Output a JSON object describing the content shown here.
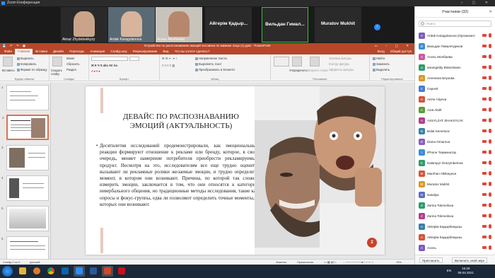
{
  "zoom": {
    "window_title": "Zoom Конференция",
    "participants": [
      {
        "name": "Aknur Zhydebekkyzy",
        "type": "video"
      },
      {
        "name": "Ardak Karagulanova",
        "type": "video"
      },
      {
        "name": "Асель Молбаева",
        "type": "video"
      },
      {
        "name": "Айгерім Қадыр...",
        "type": "name"
      },
      {
        "name": "Вильдан Гимал...",
        "type": "name"
      },
      {
        "name": "Muratov Mukhit",
        "type": "name"
      }
    ]
  },
  "ppt": {
    "title": "Устройство по распознаванию эмоций человека по мимике лица (1).pptx - PowerPoint",
    "tabs": [
      "Файл",
      "Главная",
      "Вставка",
      "Дизайн",
      "Переходы",
      "Анимация",
      "Слайд-шоу",
      "Рецензирование",
      "Вид",
      "Что вы хотите сделать?"
    ],
    "active_tab": "Главная",
    "account": "Вход",
    "share": "Общий доступ",
    "ribbon": {
      "paste": "Вставить",
      "cut": "Вырезать",
      "copy": "Копировать",
      "format_painter": "Формат по образцу",
      "clipboard": "Буфер обмена",
      "new_slide": "Создать слайд",
      "layout": "Макет",
      "reset": "Сбросить",
      "section": "Раздел",
      "slides": "Слайды",
      "font": "Шрифт",
      "paragraph": "Абзац",
      "text_direction": "Направление текста",
      "align_text": "Выровнять текст",
      "smartart": "Преобразовать в SmartArt",
      "arrange": "Упорядочить",
      "quick_styles": "Экспресс-стили",
      "shape_fill": "Заливка фигуры",
      "shape_outline": "Контур фигуры",
      "shape_effects": "Эффекты фигуры",
      "drawing": "Рисование",
      "find": "Найти",
      "replace": "Заменить",
      "select": "Выделить",
      "editing": "Редактирование"
    },
    "slide": {
      "number": "2",
      "title": "ДЕВАЙС ПО РАСПОЗНАВАНИЮ ЭМОЦИЙ (АКТУАЛЬНОСТЬ)",
      "body": "Десятилетия исследований продемонстрировали, как эмоциональные реакции формируют отношение к рекламе или бренду, которое, в свою очередь, меняет намерение потребителя приобрести рекламируемый продукт. Несмотря на это, исследователям все еще трудно оценить, вызывают ли рекламные ролики желаемые эмоции, и трудно определить момент, в котором они возникают. Причина, по которой так сложно измерить эмоции, заключается в том, что они относятся к категории невербального общения, но традиционные методы исследования, такие как опросы и фокус-группы, едва ли позволяют определить точные моменты, в которых они возникают."
    },
    "thumb_numbers": [
      "1",
      "2",
      "3",
      "4",
      "5",
      "6"
    ],
    "status": {
      "slide_count": "Слайд 2 из 9",
      "language": "русский",
      "notes": "Заметки",
      "comments": "Примечания",
      "zoom": "78%"
    }
  },
  "panel": {
    "title": "Участники (32)",
    "search_placeholder": "Поиск",
    "people": [
      {
        "name": "Ardak Karagulanova (Организатор)",
        "initial": "A",
        "color": "#7a5cc4"
      },
      {
        "name": "Вильдан Гималетдинов",
        "initial": "В",
        "color": "#3b8fd6"
      },
      {
        "name": "Асель Молбаева",
        "initial": "А",
        "color": "#c75b9b"
      },
      {
        "name": "amangeldy Bissenbaev",
        "initial": "a",
        "color": "#2f9c6a"
      },
      {
        "name": "Ангелина Беузова",
        "initial": "А",
        "color": "#d99a2b"
      },
      {
        "name": "Сергей",
        "initial": "С",
        "color": "#4a7bd0"
      },
      {
        "name": "Aiche Aliyeva",
        "initial": "A",
        "color": "#d4553b"
      },
      {
        "name": "Azat Abdil",
        "initial": "A",
        "color": "#5c9c3b"
      },
      {
        "name": "ASSYLZAT ZHAKSYLYK",
        "initial": "A",
        "color": "#b0408c"
      },
      {
        "name": "Bolat Kenessov",
        "initial": "B",
        "color": "#3b7fa8"
      },
      {
        "name": "Diana Omarova",
        "initial": "D",
        "color": "#8c5cc4"
      },
      {
        "name": "iPhone Терминатор",
        "initial": "i",
        "color": "#3b8fd6"
      },
      {
        "name": "Kalampyr Orazymbetova",
        "initial": "K",
        "color": "#2f9c6a"
      },
      {
        "name": "Marzhan Alkibayeva",
        "initial": "M",
        "color": "#d4553b"
      },
      {
        "name": "Muratov Mukhit",
        "initial": "M",
        "color": "#d99a2b"
      },
      {
        "name": "Nataliya",
        "initial": "N",
        "color": "#5b6fc4"
      },
      {
        "name": "Zarina Tokmeilova",
        "initial": "Z",
        "color": "#2f9c6a"
      },
      {
        "name": "Zarina Tokmeilova",
        "initial": "Z",
        "color": "#b0408c"
      },
      {
        "name": "Айгерім Кадырбекқызы",
        "initial": "А",
        "color": "#3b7fa8"
      },
      {
        "name": "Айгерім Кадырбекқызы",
        "initial": "А",
        "color": "#d4553b"
      },
      {
        "name": "Асель",
        "initial": "А",
        "color": "#7a5cc4"
      }
    ],
    "invite": "Пригласить",
    "mute_me": "Включить свой звук"
  },
  "taskbar": {
    "lang": "EN",
    "time": "16:29",
    "date": "08.04.2021"
  }
}
